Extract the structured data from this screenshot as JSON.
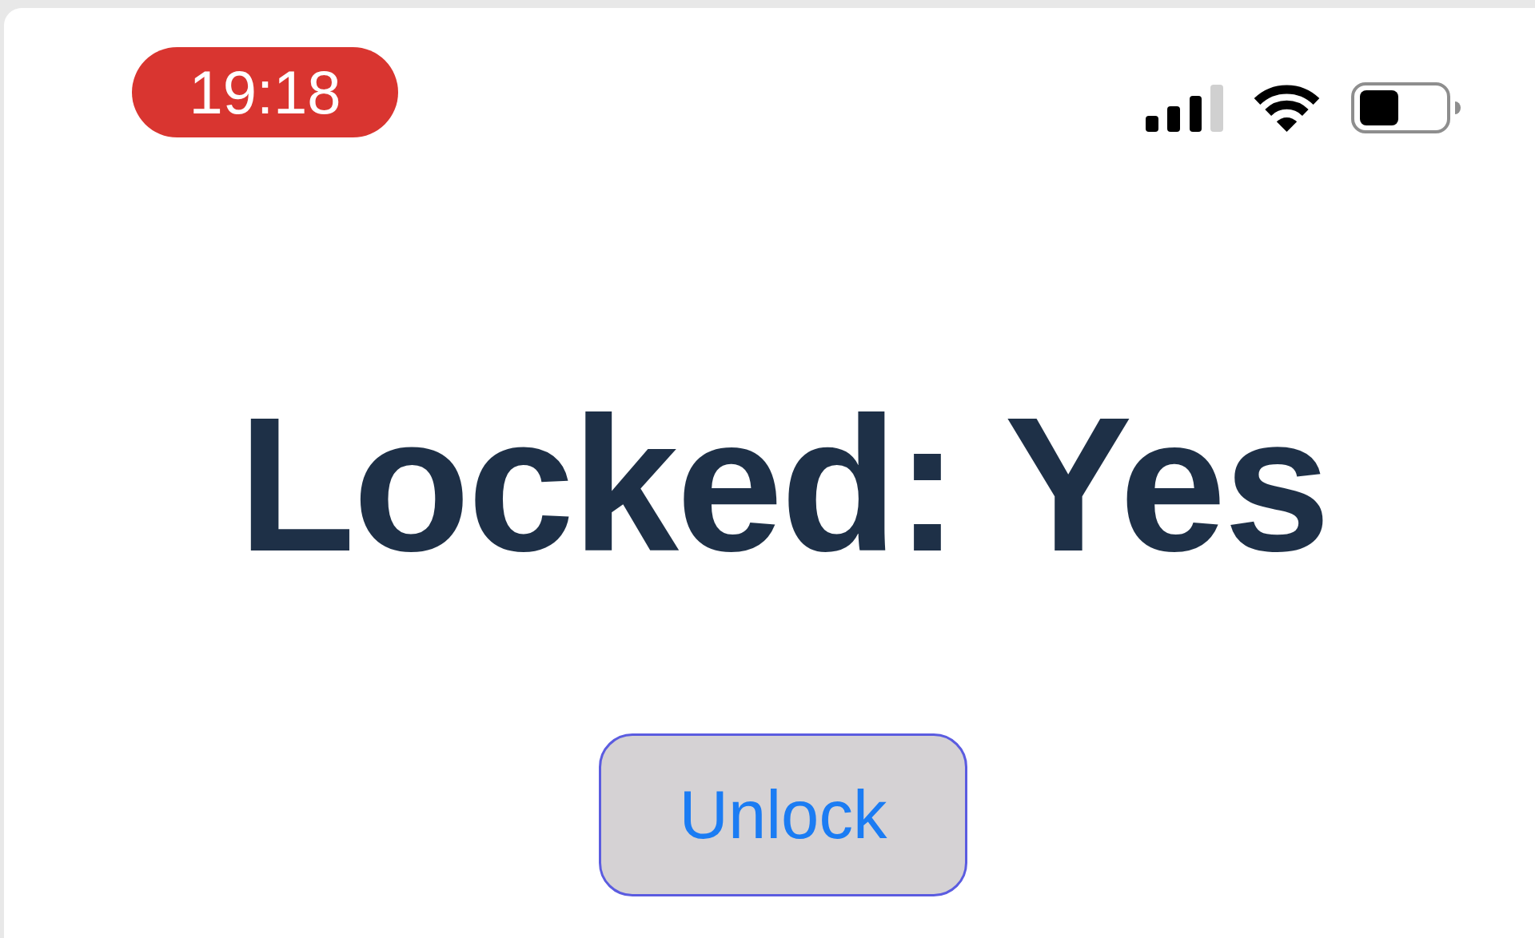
{
  "status_bar": {
    "time": "19:18",
    "recording": true
  },
  "heading": "Locked: Yes",
  "buttons": [
    {
      "label": "Unlock"
    }
  ]
}
